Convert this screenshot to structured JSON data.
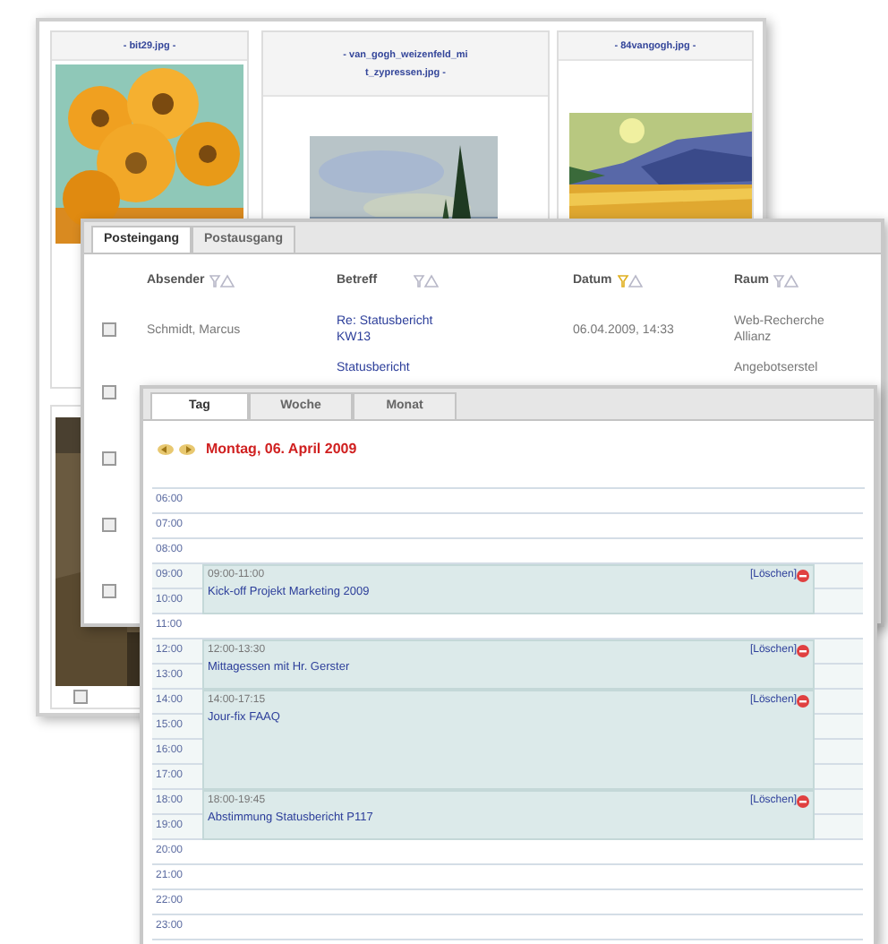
{
  "gallery": {
    "cards": [
      {
        "caption": "- bit29.jpg -"
      },
      {
        "caption": "- van_gogh_weizenfeld_mit_zypressen.jpg -"
      },
      {
        "caption": "- 84vangogh.jpg -"
      },
      {
        "checked": false
      }
    ]
  },
  "mail": {
    "tabs": [
      {
        "label": "Posteingang",
        "selected": true
      },
      {
        "label": "Postausgang",
        "selected": false
      }
    ],
    "columns": [
      {
        "label": "Absender",
        "active": false
      },
      {
        "label": "Betreff",
        "active": false
      },
      {
        "label": "Datum",
        "active": true
      },
      {
        "label": "Raum",
        "active": false
      }
    ],
    "rows": [
      {
        "checked": false,
        "sender": "Schmidt, Marcus",
        "subject": "Re: Statusbericht KW13",
        "date": "06.04.2009, 14:33",
        "room": "Web-Recherche Allianz"
      },
      {
        "checked": false,
        "subject": "Statusbericht",
        "room": "Angebotserstel"
      },
      {
        "checked": false
      },
      {
        "checked": false
      },
      {
        "checked": false
      }
    ]
  },
  "calendar": {
    "tabs": [
      {
        "label": "Tag",
        "selected": true
      },
      {
        "label": "Woche",
        "selected": false
      },
      {
        "label": "Monat",
        "selected": false
      }
    ],
    "date": "Montag, 06. April 2009",
    "hours": [
      {
        "label": "06:00",
        "busy": false
      },
      {
        "label": "07:00",
        "busy": false
      },
      {
        "label": "08:00",
        "busy": false
      },
      {
        "label": "09:00",
        "busy": true,
        "event": {
          "time": "09:00-11:00",
          "title": "Kick-off Projekt Marketing 2009",
          "action": "[Löschen]"
        }
      },
      {
        "label": "10:00",
        "busy": true
      },
      {
        "label": "11:00",
        "busy": false
      },
      {
        "label": "12:00",
        "busy": true,
        "event": {
          "time": "12:00-13:30",
          "title": "Mittagessen mit Hr. Gerster",
          "action": "[Löschen]"
        }
      },
      {
        "label": "13:00",
        "busy": true
      },
      {
        "label": "14:00",
        "busy": true,
        "event": {
          "time": "14:00-17:15",
          "title": "Jour-fix FAAQ",
          "action": "[Löschen]"
        }
      },
      {
        "label": "15:00",
        "busy": true
      },
      {
        "label": "16:00",
        "busy": true
      },
      {
        "label": "17:00",
        "busy": true
      },
      {
        "label": "18:00",
        "busy": true,
        "event": {
          "time": "18:00-19:45",
          "title": "Abstimmung Statusbericht P117",
          "action": "[Löschen]"
        }
      },
      {
        "label": "19:00",
        "busy": true
      },
      {
        "label": "20:00",
        "busy": false
      },
      {
        "label": "21:00",
        "busy": false
      },
      {
        "label": "22:00",
        "busy": false
      },
      {
        "label": "23:00",
        "busy": false
      }
    ]
  }
}
